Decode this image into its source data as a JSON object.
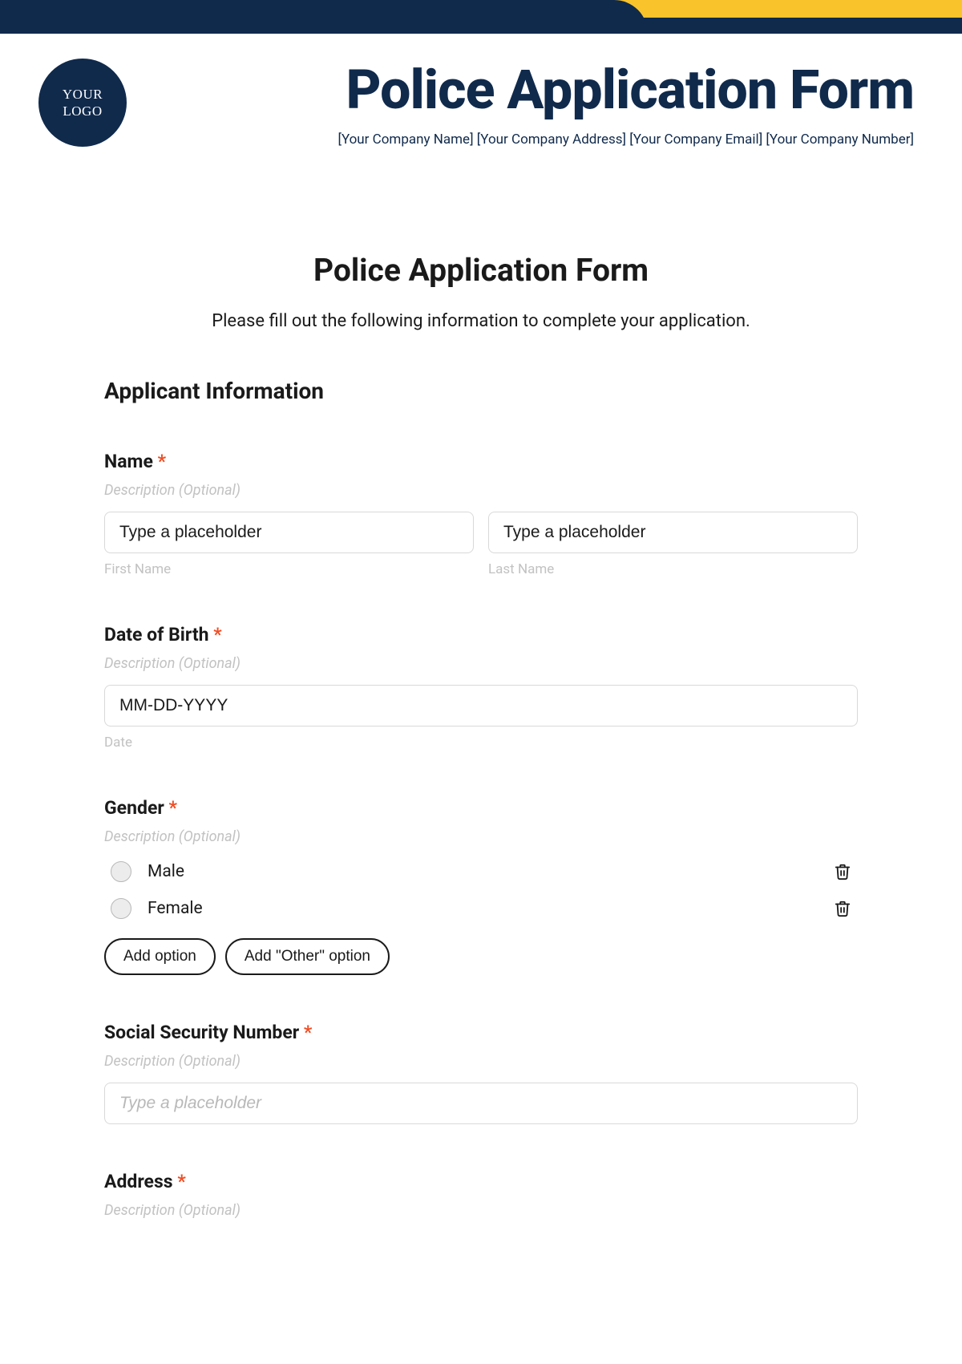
{
  "banner": {
    "logo_line1": "YOUR",
    "logo_line2": "LOGO",
    "title": "Police Application Form",
    "subinfo": "[Your Company Name] [Your Company Address] [Your Company Email] [Your Company Number]"
  },
  "form": {
    "title": "Police Application Form",
    "intro": "Please fill out the following information to complete your application.",
    "section": "Applicant Information",
    "desc_placeholder": "Description (Optional)",
    "name": {
      "label": "Name",
      "first_ph": "Type a placeholder",
      "last_ph": "Type a placeholder",
      "first_sub": "First Name",
      "last_sub": "Last Name"
    },
    "dob": {
      "label": "Date of Birth",
      "ph": "MM-DD-YYYY",
      "sub": "Date"
    },
    "gender": {
      "label": "Gender",
      "opt1": "Male",
      "opt2": "Female",
      "add_option": "Add option",
      "add_other": "Add \"Other\" option"
    },
    "ssn": {
      "label": "Social Security Number",
      "ph": "Type a placeholder"
    },
    "address": {
      "label": "Address"
    }
  }
}
